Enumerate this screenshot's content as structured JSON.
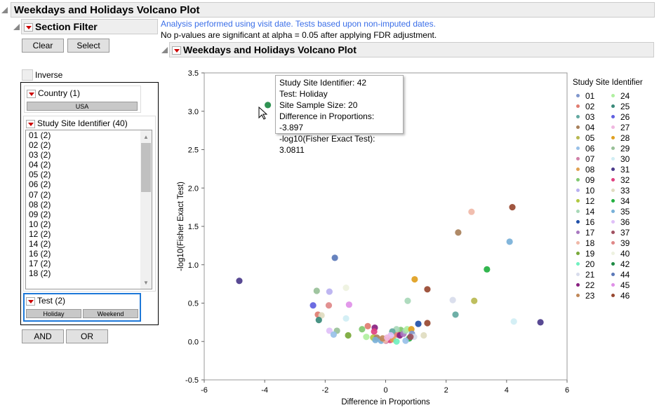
{
  "title": "Weekdays and Holidays Volcano Plot",
  "filter": {
    "title": "Section Filter",
    "clear": "Clear",
    "select": "Select",
    "inverse": "Inverse",
    "country": {
      "label": "Country (1)",
      "values": [
        "USA"
      ]
    },
    "site": {
      "label": "Study Site Identifier (40)",
      "items": [
        "01 (2)",
        "02 (2)",
        "03 (2)",
        "04 (2)",
        "05 (2)",
        "06 (2)",
        "07 (2)",
        "08 (2)",
        "09 (2)",
        "10 (2)",
        "12 (2)",
        "14 (2)",
        "16 (2)",
        "17 (2)",
        "18 (2)"
      ]
    },
    "test": {
      "label": "Test (2)",
      "values": [
        "Holiday",
        "Weekend"
      ]
    },
    "and": "AND",
    "or": "OR"
  },
  "notes": [
    "Analysis performed using visit date. Tests based upon non-imputed dates.",
    "No p-values are significant at alpha = 0.05 after applying FDR adjustment."
  ],
  "plot_title": "Weekdays and Holidays Volcano Plot",
  "tooltip": [
    "Study Site Identifier: 42",
    "Test: Holiday",
    "Site Sample Size: 20",
    "Difference in Proportions: -3.897",
    "-log10(Fisher Exact Test): 3.0811"
  ],
  "colors": {
    "01": "#7f96cc",
    "02": "#e07c70",
    "03": "#62a8a0",
    "04": "#a8805a",
    "05": "#b8b850",
    "06": "#98c0e8",
    "07": "#d080a8",
    "08": "#e0a050",
    "09": "#80c870",
    "10": "#b8b0f0",
    "12": "#b0c840",
    "14": "#a8d8b8",
    "16": "#2050a8",
    "17": "#a878c0",
    "18": "#f0b8a8",
    "19": "#78a838",
    "20": "#70f0c0",
    "21": "#d8dcec",
    "22": "#882080",
    "23": "#c08858",
    "24": "#b0f0a0",
    "25": "#3a8a7a",
    "26": "#6060e0",
    "27": "#f0b8e0",
    "28": "#e0a020",
    "29": "#98c098",
    "30": "#d0eef4",
    "31": "#4a3a8a",
    "32": "#e04080",
    "33": "#e0dcc0",
    "34": "#22b040",
    "35": "#78b0d8",
    "36": "#e0c0f8",
    "37": "#a05060",
    "39": "#e08888",
    "40": "#eef2e0",
    "42": "#1e8a44",
    "44": "#5a78b8",
    "45": "#e090e8",
    "46": "#984830"
  },
  "chart_data": {
    "type": "scatter",
    "title": "Weekdays and Holidays Volcano Plot",
    "xlabel": "Difference in Proportions",
    "ylabel": "-log10(Fisher Exact Test)",
    "xlim": [
      -6,
      6
    ],
    "ylim": [
      -0.5,
      3.5
    ],
    "xticks": [
      -6,
      -4,
      -2,
      0,
      2,
      4,
      6
    ],
    "yticks": [
      -0.5,
      0.0,
      0.5,
      1.0,
      1.5,
      2.0,
      2.5,
      3.0,
      3.5
    ],
    "legend_title": "Study Site Identifier",
    "legend_position": "right",
    "legend": [
      "01",
      "02",
      "03",
      "04",
      "05",
      "06",
      "07",
      "08",
      "09",
      "10",
      "12",
      "14",
      "16",
      "17",
      "18",
      "19",
      "20",
      "21",
      "22",
      "23",
      "24",
      "25",
      "26",
      "27",
      "28",
      "29",
      "30",
      "31",
      "32",
      "33",
      "34",
      "35",
      "36",
      "37",
      "39",
      "40",
      "42",
      "44",
      "45",
      "46"
    ],
    "points": [
      {
        "site": "42",
        "x": -3.897,
        "y": 3.081
      },
      {
        "site": "31",
        "x": -4.84,
        "y": 0.79
      },
      {
        "site": "44",
        "x": -1.68,
        "y": 1.09
      },
      {
        "site": "18",
        "x": 2.84,
        "y": 1.69
      },
      {
        "site": "46",
        "x": 4.19,
        "y": 1.75
      },
      {
        "site": "04",
        "x": 2.4,
        "y": 1.42
      },
      {
        "site": "35",
        "x": 4.1,
        "y": 1.3
      },
      {
        "site": "34",
        "x": 3.35,
        "y": 0.94
      },
      {
        "site": "28",
        "x": 0.96,
        "y": 0.81
      },
      {
        "site": "46",
        "x": 1.38,
        "y": 0.68
      },
      {
        "site": "05",
        "x": 2.93,
        "y": 0.53
      },
      {
        "site": "21",
        "x": 2.22,
        "y": 0.54
      },
      {
        "site": "03",
        "x": 2.31,
        "y": 0.35
      },
      {
        "site": "30",
        "x": 4.24,
        "y": 0.26
      },
      {
        "site": "31",
        "x": 5.12,
        "y": 0.25
      },
      {
        "site": "29",
        "x": -2.28,
        "y": 0.66
      },
      {
        "site": "10",
        "x": -1.86,
        "y": 0.65
      },
      {
        "site": "40",
        "x": -1.31,
        "y": 0.7
      },
      {
        "site": "26",
        "x": -2.4,
        "y": 0.47
      },
      {
        "site": "39",
        "x": -1.88,
        "y": 0.47
      },
      {
        "site": "45",
        "x": -1.21,
        "y": 0.48
      },
      {
        "site": "14",
        "x": 0.73,
        "y": 0.53
      },
      {
        "site": "30",
        "x": -1.31,
        "y": 0.3
      },
      {
        "site": "02",
        "x": -2.24,
        "y": 0.35
      },
      {
        "site": "33",
        "x": -2.12,
        "y": 0.34
      },
      {
        "site": "25",
        "x": -2.21,
        "y": 0.28
      },
      {
        "site": "36",
        "x": -1.86,
        "y": 0.14
      },
      {
        "site": "29",
        "x": -1.61,
        "y": 0.14
      },
      {
        "site": "06",
        "x": -1.72,
        "y": 0.09
      },
      {
        "site": "19",
        "x": -1.24,
        "y": 0.08
      },
      {
        "site": "16",
        "x": 1.08,
        "y": 0.23
      },
      {
        "site": "46",
        "x": 1.38,
        "y": 0.24
      },
      {
        "site": "33",
        "x": 1.26,
        "y": 0.08
      },
      {
        "site": "09",
        "x": -0.78,
        "y": 0.16
      },
      {
        "site": "02",
        "x": -0.59,
        "y": 0.2
      },
      {
        "site": "22",
        "x": -0.36,
        "y": 0.18
      },
      {
        "site": "32",
        "x": -0.38,
        "y": 0.13
      },
      {
        "site": "24",
        "x": -0.64,
        "y": 0.06
      },
      {
        "site": "12",
        "x": -0.41,
        "y": 0.05
      },
      {
        "site": "04",
        "x": -0.29,
        "y": 0.05
      },
      {
        "site": "35",
        "x": -0.15,
        "y": 0.01
      },
      {
        "site": "07",
        "x": 0.01,
        "y": 0.01
      },
      {
        "site": "32",
        "x": 0.15,
        "y": 0.02
      },
      {
        "site": "08",
        "x": 0.24,
        "y": 0.03
      },
      {
        "site": "20",
        "x": 0.36,
        "y": 0.0
      },
      {
        "site": "09",
        "x": 0.5,
        "y": 0.15
      },
      {
        "site": "02",
        "x": 0.38,
        "y": 0.09
      },
      {
        "site": "22",
        "x": 0.47,
        "y": 0.08
      },
      {
        "site": "17",
        "x": 0.59,
        "y": 0.1
      },
      {
        "site": "14",
        "x": 0.66,
        "y": 0.14
      },
      {
        "site": "24",
        "x": 0.71,
        "y": 0.16
      },
      {
        "site": "28",
        "x": 0.85,
        "y": 0.16
      },
      {
        "site": "01",
        "x": 0.87,
        "y": 0.1
      },
      {
        "site": "21",
        "x": 0.94,
        "y": 0.06
      },
      {
        "site": "34",
        "x": 0.78,
        "y": 0.04
      },
      {
        "site": "06",
        "x": 0.66,
        "y": 0.01
      },
      {
        "site": "37",
        "x": 0.82,
        "y": 0.06
      },
      {
        "site": "14",
        "x": 0.36,
        "y": 0.16
      },
      {
        "site": "03",
        "x": 0.22,
        "y": 0.13
      },
      {
        "site": "36",
        "x": 0.17,
        "y": 0.08
      },
      {
        "site": "18",
        "x": -0.01,
        "y": 0.02
      },
      {
        "site": "35",
        "x": -0.34,
        "y": 0.02
      },
      {
        "site": "23",
        "x": -0.1,
        "y": 0.04
      },
      {
        "site": "27",
        "x": 0.05,
        "y": 0.05
      }
    ]
  }
}
